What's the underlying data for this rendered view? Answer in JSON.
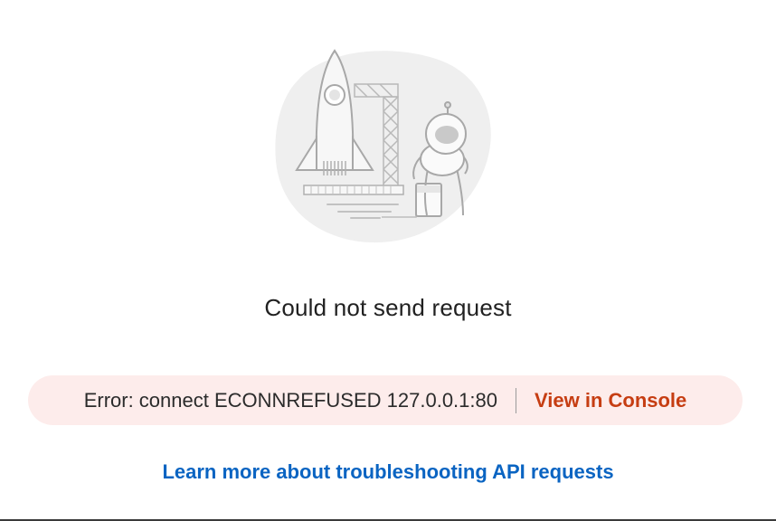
{
  "illustration": {
    "icon": "rocket-astronaut-illustration"
  },
  "message": {
    "title": "Could not send request"
  },
  "error": {
    "text": "Error: connect ECONNREFUSED 127.0.0.1:80",
    "action_label": "View in Console"
  },
  "help": {
    "link_label": "Learn more about troubleshooting API requests"
  },
  "colors": {
    "banner_bg": "#fdeceb",
    "console_link": "#c63d12",
    "help_link": "#0a64c2"
  }
}
